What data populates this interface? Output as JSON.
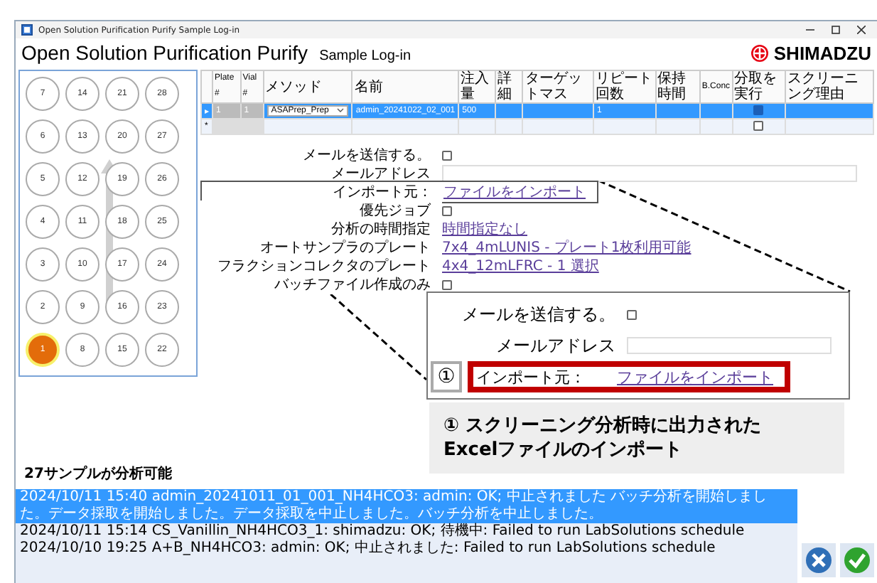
{
  "window": {
    "title": "Open Solution Purification Purify Sample Log-in"
  },
  "header": {
    "app_name": "Open Solution Purification Purify",
    "screen_name": "Sample Log-in",
    "brand": "SHIMADZU"
  },
  "plate": {
    "wells": [
      {
        "label": "7",
        "selected": false
      },
      {
        "label": "14",
        "selected": false
      },
      {
        "label": "21",
        "selected": false
      },
      {
        "label": "28",
        "selected": false
      },
      {
        "label": "6",
        "selected": false
      },
      {
        "label": "13",
        "selected": false
      },
      {
        "label": "20",
        "selected": false
      },
      {
        "label": "27",
        "selected": false
      },
      {
        "label": "5",
        "selected": false
      },
      {
        "label": "12",
        "selected": false
      },
      {
        "label": "19",
        "selected": false
      },
      {
        "label": "26",
        "selected": false
      },
      {
        "label": "4",
        "selected": false
      },
      {
        "label": "11",
        "selected": false
      },
      {
        "label": "18",
        "selected": false
      },
      {
        "label": "25",
        "selected": false
      },
      {
        "label": "3",
        "selected": false
      },
      {
        "label": "10",
        "selected": false
      },
      {
        "label": "17",
        "selected": false
      },
      {
        "label": "24",
        "selected": false
      },
      {
        "label": "2",
        "selected": false
      },
      {
        "label": "9",
        "selected": false
      },
      {
        "label": "16",
        "selected": false
      },
      {
        "label": "23",
        "selected": false
      },
      {
        "label": "1",
        "selected": true
      },
      {
        "label": "8",
        "selected": false
      },
      {
        "label": "15",
        "selected": false
      },
      {
        "label": "22",
        "selected": false
      }
    ]
  },
  "table": {
    "columns": [
      "Plate #",
      "Vial #",
      "メソッド",
      "名前",
      "注入量",
      "詳細",
      "ターゲットマス",
      "リピート回数",
      "保持時間",
      "B.Conc",
      "分取を実行",
      "スクリーニング理由"
    ],
    "rows": [
      {
        "marker": "▸",
        "selected": true,
        "plate": "1",
        "vial": "1",
        "method": "ASAPrep_Prep",
        "name": "admin_20241022_02_001",
        "volume": "500",
        "repeat": "1",
        "fractionate": true
      },
      {
        "marker": "*",
        "selected": false,
        "fractionate": false
      }
    ]
  },
  "form": {
    "rows": [
      {
        "kind": "checkbox",
        "label": "メールを送信する。",
        "checked": false,
        "highlighted": false
      },
      {
        "kind": "field",
        "label": "メールアドレス",
        "highlighted": false
      },
      {
        "kind": "link",
        "label": "インポート元：",
        "link": "ファイルをインポート",
        "highlighted": true
      },
      {
        "kind": "checkbox",
        "label": "優先ジョブ",
        "checked": false,
        "highlighted": false
      },
      {
        "kind": "link",
        "label": "分析の時間指定",
        "link": "時間指定なし",
        "highlighted": false
      },
      {
        "kind": "link",
        "label": "オートサンプラのプレート",
        "link": "7x4_4mLUNIS - プレート1枚利用可能",
        "highlighted": false
      },
      {
        "kind": "link",
        "label": "フラクションコレクタのプレート",
        "link": "4x4_12mLFRC - 1 選択",
        "highlighted": false
      },
      {
        "kind": "checkbox",
        "label": "バッチファイル作成のみ",
        "checked": false,
        "highlighted": false
      }
    ]
  },
  "callout": {
    "number": "①",
    "rows": [
      {
        "kind": "checkbox",
        "label": "メールを送信する。",
        "checked": false,
        "highlighted": false
      },
      {
        "kind": "field",
        "label": "メールアドレス",
        "highlighted": false
      },
      {
        "kind": "link",
        "label": "インポート元：",
        "link": "ファイルをインポート",
        "highlighted": true
      }
    ],
    "caption": "① スクリーニング分析時に出力された\nExcelファイルのインポート"
  },
  "status": "27サンプルが分析可能",
  "log": [
    {
      "text": "2024/10/11 15:40 admin_20241011_01_001_NH4HCO3: admin: OK; 中止されました バッチ分析を開始しました。データ採取を開始しました。データ採取を中止しました。バッチ分析を中止しました。",
      "selected": true
    },
    {
      "text": "2024/10/11 15:14 CS_Vanillin_NH4HCO3_1: shimadzu: OK; 待機中: Failed to run LabSolutions schedule",
      "selected": false
    },
    {
      "text": "2024/10/10 19:25 A+B_NH4HCO3: admin: OK; 中止されました: Failed to run LabSolutions schedule",
      "selected": false
    }
  ]
}
